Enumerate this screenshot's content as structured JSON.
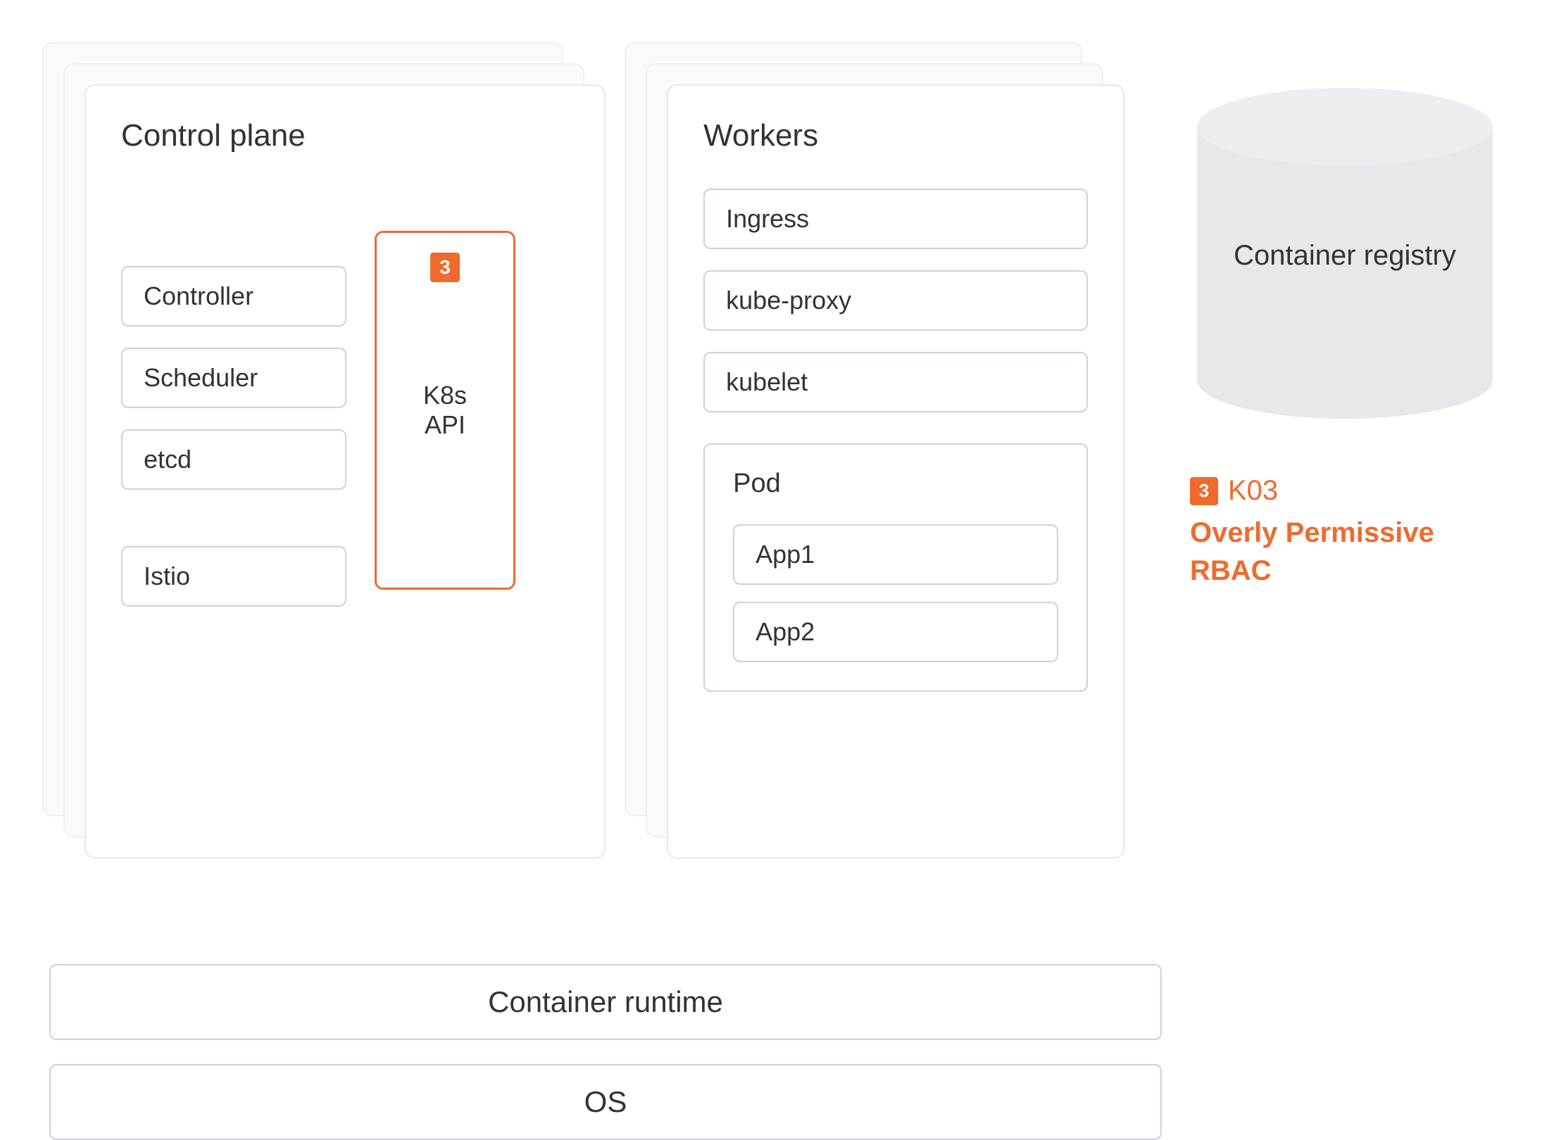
{
  "control_plane": {
    "title": "Control plane",
    "items": [
      "Controller",
      "Scheduler",
      "etcd"
    ],
    "istio": "Istio",
    "api_box": {
      "label": "K8s\nAPI",
      "tag": "3"
    }
  },
  "workers": {
    "title": "Workers",
    "items": [
      "Ingress",
      "kube-proxy",
      "kubelet"
    ],
    "pod": {
      "title": "Pod",
      "apps": [
        "App1",
        "App2"
      ]
    }
  },
  "registry": {
    "label": "Container registry"
  },
  "callout": {
    "tag": "3",
    "code": "K03",
    "desc": "Overly Permissive RBAC"
  },
  "bars": {
    "runtime": "Container runtime",
    "os": "OS"
  },
  "colors": {
    "accent": "#ee6b2d",
    "box_border": "#cfcfe0",
    "panel_border": "#e8e8ec"
  }
}
